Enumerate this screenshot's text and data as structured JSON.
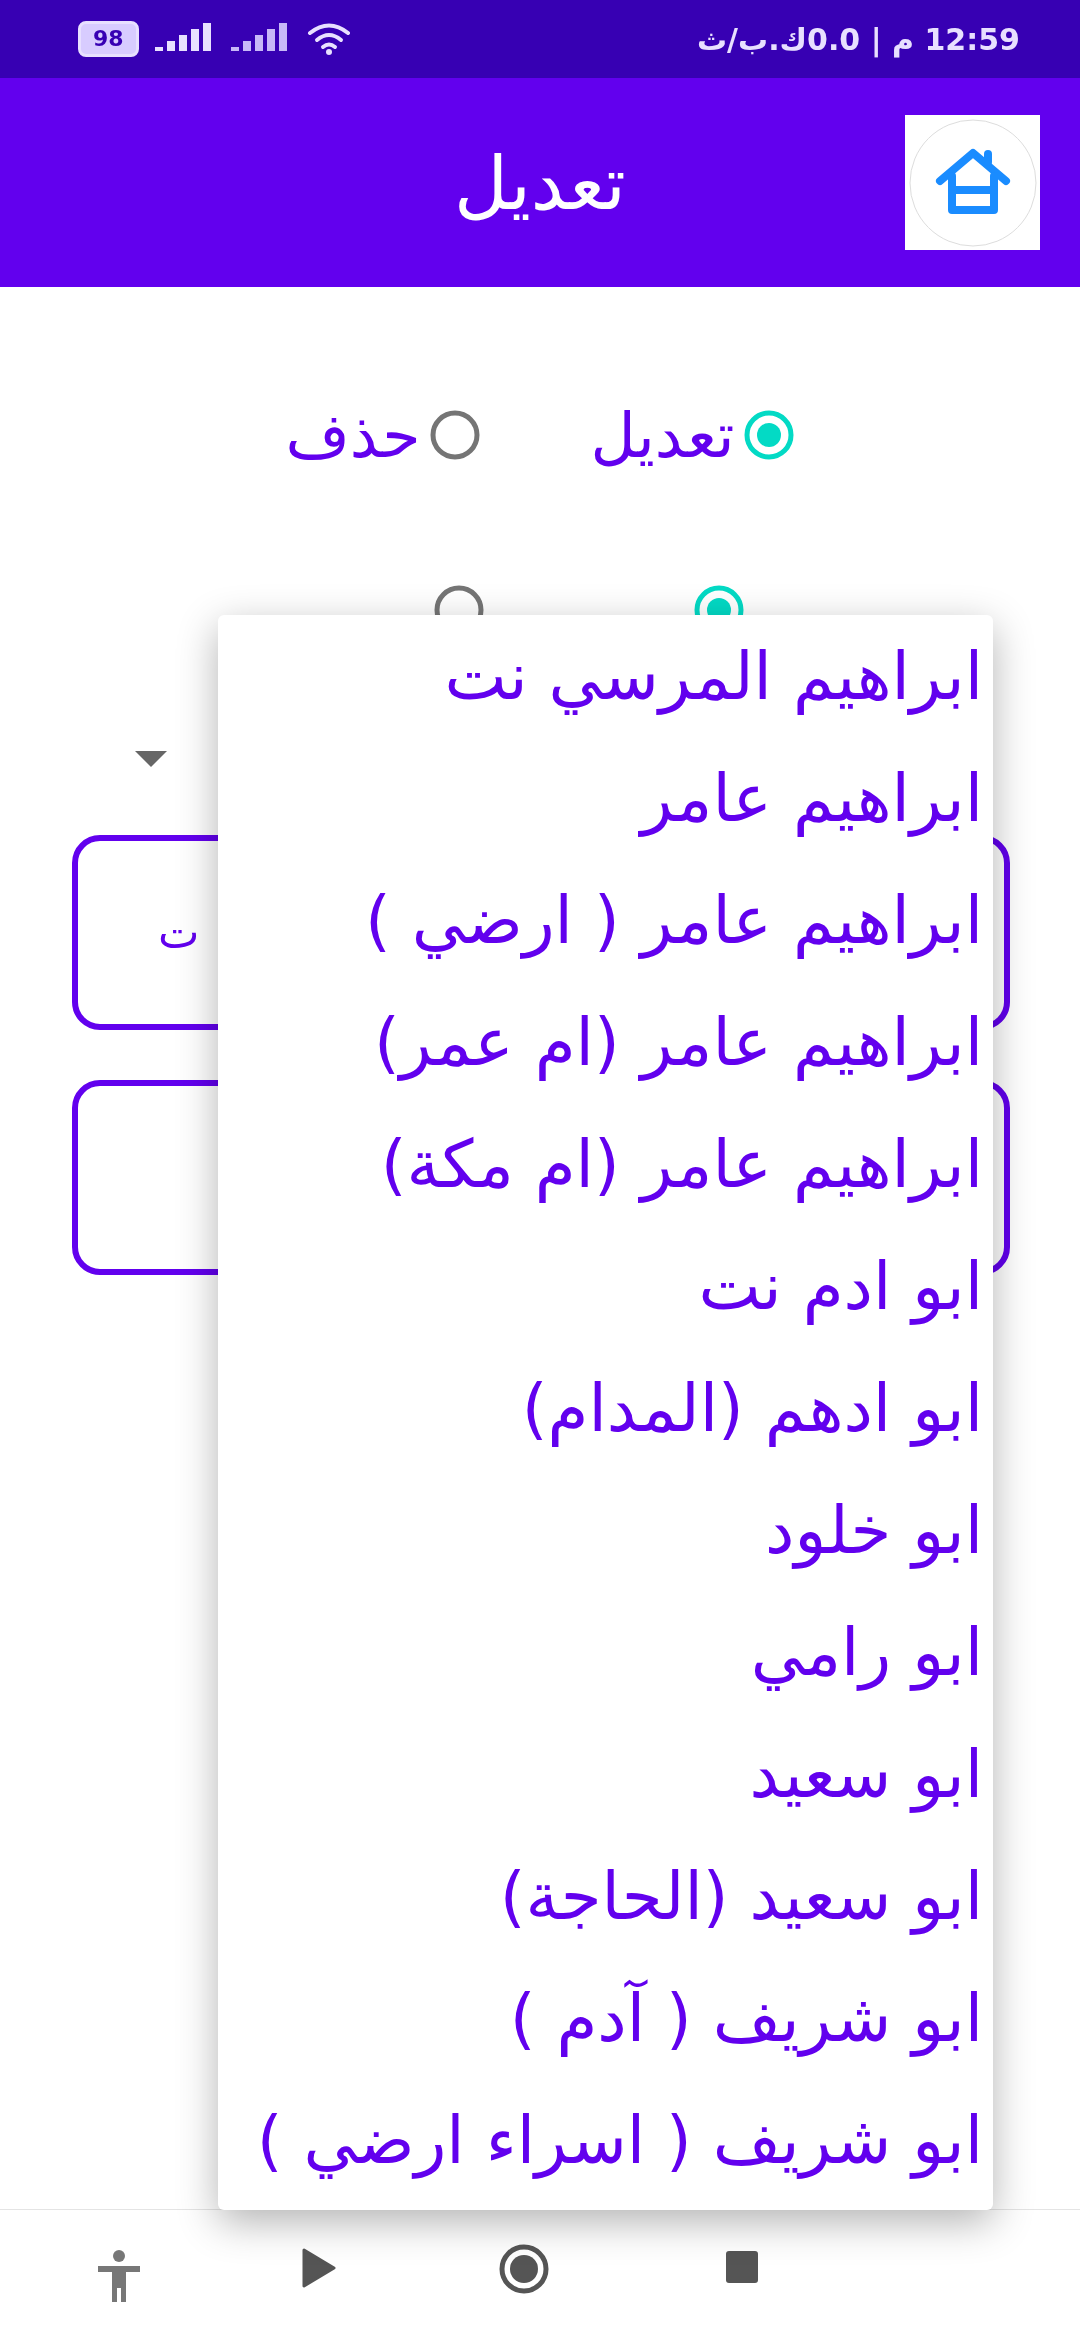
{
  "status_bar": {
    "battery": "98",
    "network_info": "12:59 م | 0.0ك.ب/ث"
  },
  "app_bar": {
    "title": "تعديل"
  },
  "action_options": [
    {
      "label": "تعديل",
      "selected": true
    },
    {
      "label": "حذف",
      "selected": false
    }
  ],
  "second_options": [
    {
      "selected": true
    },
    {
      "selected": false
    }
  ],
  "fields": [
    {
      "kind": "filled",
      "text": "ت"
    },
    {
      "kind": "empty"
    }
  ],
  "dropdown": {
    "expanded": true,
    "options": [
      {
        "label": "ابراهيم المرسي نت"
      },
      {
        "label": "ابراهيم عامر"
      },
      {
        "label": "ابراهيم عامر ( ارضي )"
      },
      {
        "label": "ابراهيم عامر (ام عمر)"
      },
      {
        "label": "ابراهيم عامر (ام مكة)"
      },
      {
        "label": "ابو ادم نت"
      },
      {
        "label": "ابو ادهم (المدام)"
      },
      {
        "label": "ابو خلود"
      },
      {
        "label": "ابو رامي"
      },
      {
        "label": "ابو سعيد"
      },
      {
        "label": "ابو سعيد (الحاجة)"
      },
      {
        "label": "ابو شريف ( آدم )"
      },
      {
        "label": "ابو شريف ( اسراء ارضي )"
      }
    ]
  }
}
